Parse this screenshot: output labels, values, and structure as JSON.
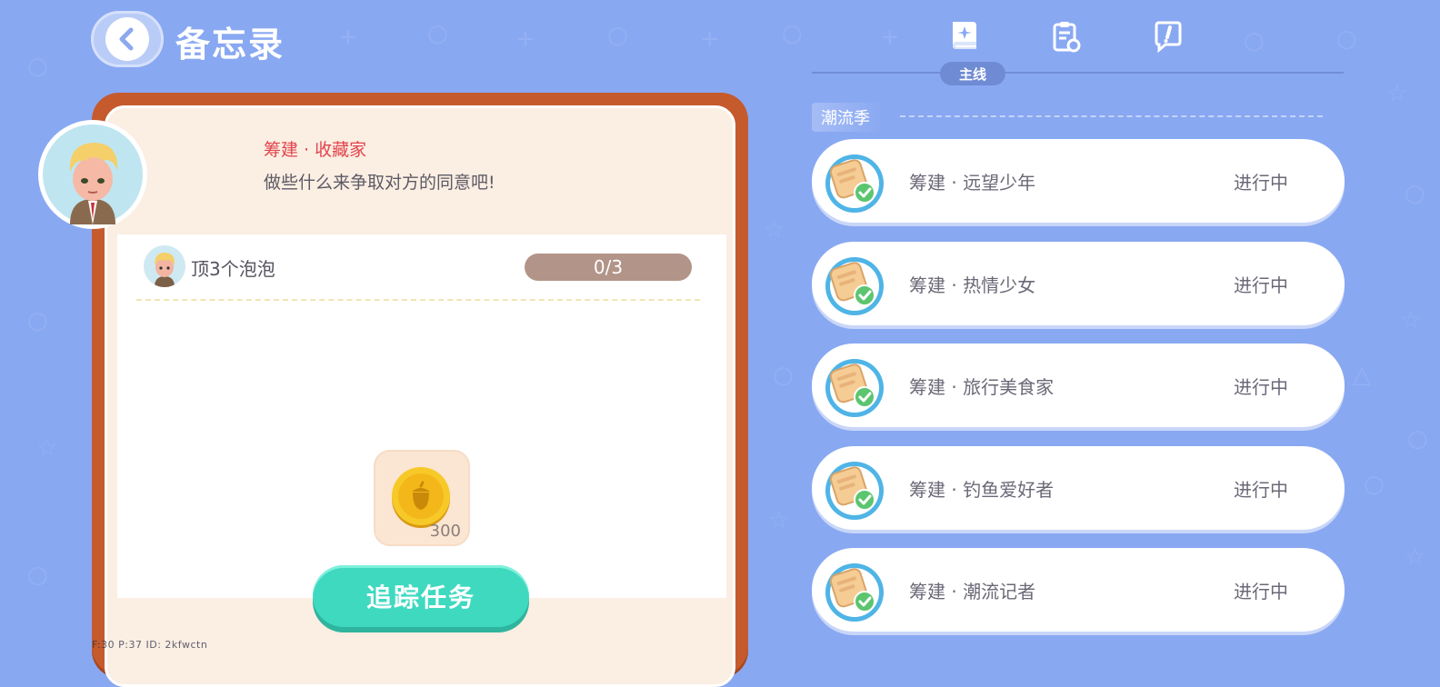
{
  "header": {
    "title": "备忘录"
  },
  "tabs": {
    "items": [
      {
        "icon": "main-quest-book-icon"
      },
      {
        "icon": "clipboard-refresh-icon"
      },
      {
        "icon": "chat-exclamation-icon"
      }
    ],
    "active_label": "主线"
  },
  "detail": {
    "npc_name": "筹建 · 收藏家",
    "npc_description": "做些什么来争取对方的同意吧!",
    "task": {
      "label": "顶3个泡泡",
      "progress_text": "0/3",
      "current": 0,
      "total": 3
    },
    "reward": {
      "icon": "acorn-coin-icon",
      "count": "300"
    },
    "track_button": "追踪任务"
  },
  "debug_overlay": "F:30   P:37   ID: 2kfwctn",
  "season": {
    "title": "潮流季",
    "quests": [
      {
        "name": "筹建 · 远望少年",
        "status": "进行中"
      },
      {
        "name": "筹建 · 热情少女",
        "status": "进行中"
      },
      {
        "name": "筹建 · 旅行美食家",
        "status": "进行中"
      },
      {
        "name": "筹建 · 钓鱼爱好者",
        "status": "进行中"
      },
      {
        "name": "筹建 · 潮流记者",
        "status": "进行中"
      }
    ]
  },
  "colors": {
    "background": "#89a8f2",
    "card_border": "#c55a2d",
    "accent_red": "#e2444d",
    "track_button": "#3fd9c0",
    "progress_bar": "#b29489"
  }
}
